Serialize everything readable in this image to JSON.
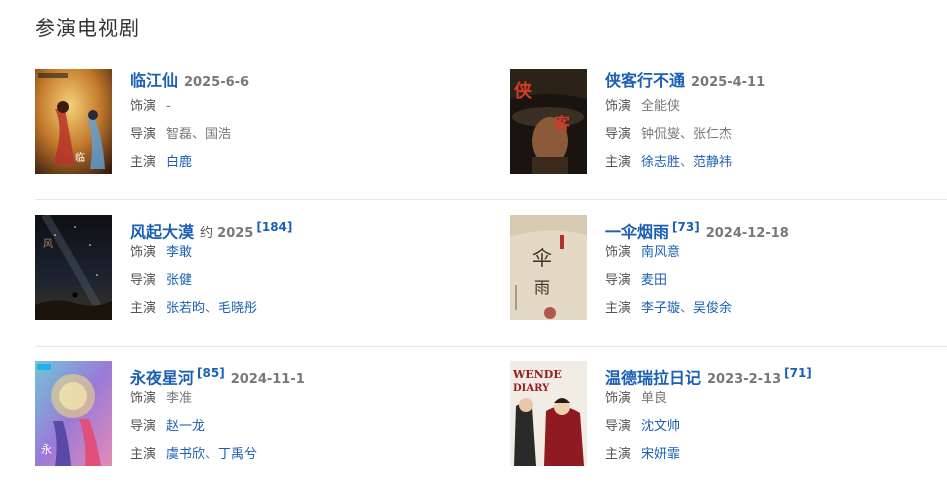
{
  "section": {
    "title": "参演电视剧"
  },
  "labels": {
    "role": "饰演",
    "director": "导演",
    "cast": "主演",
    "separator": "、"
  },
  "cards": [
    {
      "title": "临江仙",
      "score": "",
      "approx": "",
      "date": "2025-6-6",
      "role": "-",
      "role_linked": false,
      "directors": [
        "智磊",
        "国浩"
      ],
      "directors_linked": false,
      "cast": [
        "白鹿"
      ],
      "cast_linked": true
    },
    {
      "title": "侠客行不通",
      "score": "",
      "approx": "",
      "date": "2025-4-11",
      "role": "全能侠",
      "role_linked": false,
      "directors": [
        "钟侃燮",
        "张仁杰"
      ],
      "directors_linked": false,
      "cast": [
        "徐志胜",
        "范静祎"
      ],
      "cast_linked": true
    },
    {
      "title": "风起大漠",
      "score": "[184]",
      "approx": "约",
      "date": "2025",
      "role": "李敢",
      "role_linked": true,
      "directors": [
        "张健"
      ],
      "directors_linked": true,
      "cast": [
        "张若昀",
        "毛晓彤"
      ],
      "cast_linked": true
    },
    {
      "title": "一伞烟雨",
      "score": "[73]",
      "approx": "",
      "date": "2024-12-18",
      "role": "南风意",
      "role_linked": true,
      "directors": [
        "麦田"
      ],
      "directors_linked": true,
      "cast": [
        "李子璇",
        "吴俊余"
      ],
      "cast_linked": true
    },
    {
      "title": "永夜星河",
      "score": "[85]",
      "approx": "",
      "date": "2024-11-1",
      "role": "李准",
      "role_linked": false,
      "directors": [
        "赵一龙"
      ],
      "directors_linked": true,
      "cast": [
        "虞书欣",
        "丁禹兮"
      ],
      "cast_linked": true
    },
    {
      "title": "温德瑞拉日记",
      "score": "[71]",
      "approx": "",
      "date": "2023-2-13",
      "role": "单良",
      "role_linked": false,
      "directors": [
        "沈文帅"
      ],
      "directors_linked": true,
      "cast": [
        "宋妍霏"
      ],
      "cast_linked": true
    }
  ]
}
